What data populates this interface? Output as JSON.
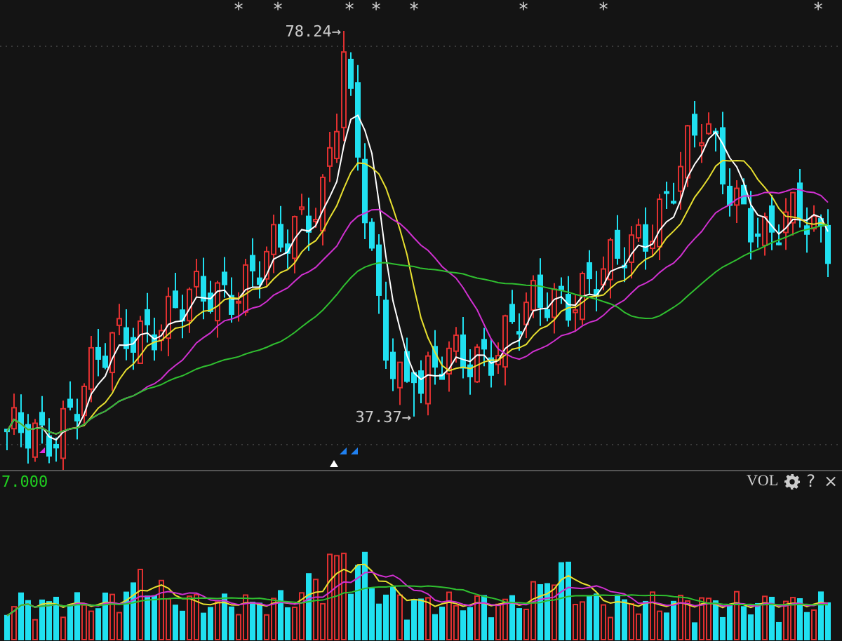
{
  "main_chart": {
    "event_marks": [
      "*",
      "*",
      "*",
      "*",
      "*",
      "*",
      "*",
      "*"
    ],
    "high_label": "78.24→",
    "low_label": "37.37→"
  },
  "volume_panel": {
    "value_label": "7.000",
    "indicator": "VOL",
    "help": "?",
    "close": "×"
  }
}
